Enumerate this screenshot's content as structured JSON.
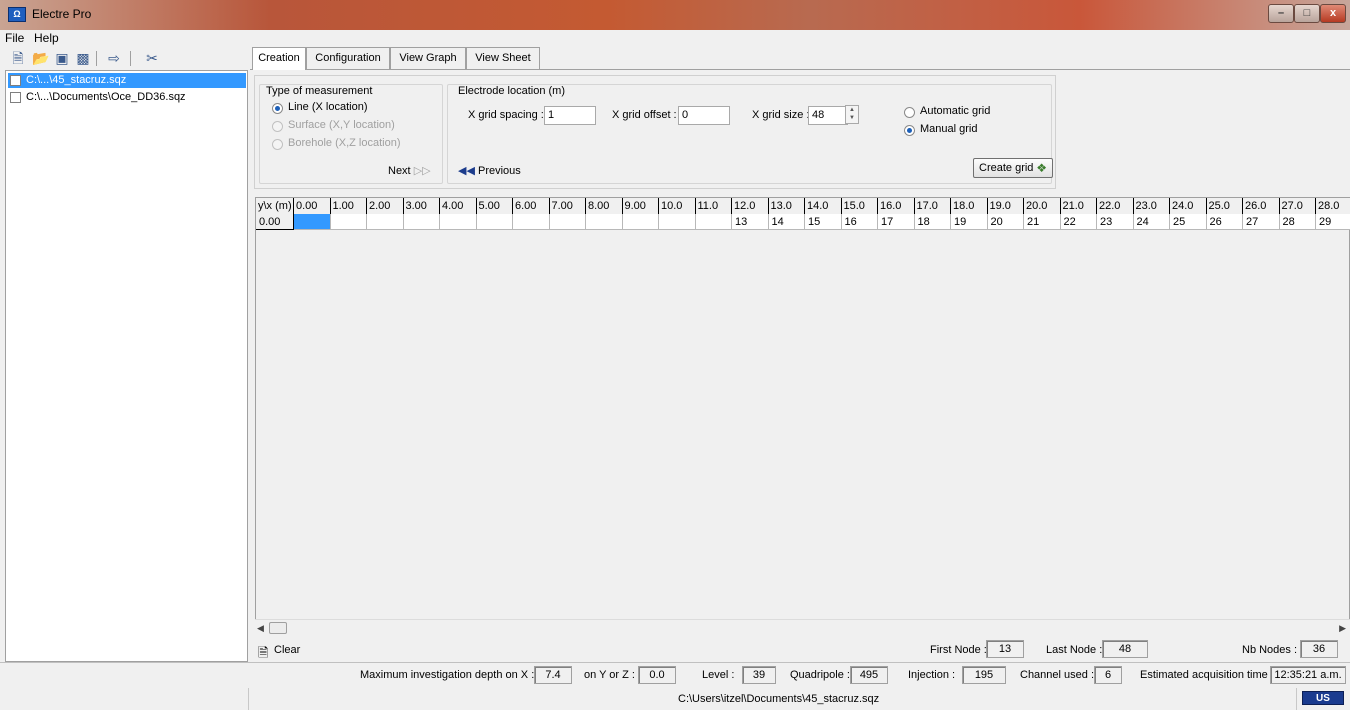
{
  "window": {
    "title": "Electre Pro",
    "icon": "electre-app-icon",
    "min": "–",
    "max": "□",
    "close": "x"
  },
  "menu": [
    "File",
    "Help"
  ],
  "files": [
    {
      "name": "C:\\...\\45_stacruz.sqz",
      "selected": true
    },
    {
      "name": "C:\\...\\Documents\\Oce_DD36.sqz",
      "selected": false
    }
  ],
  "tabs": [
    "Creation",
    "Configuration",
    "View Graph",
    "View Sheet"
  ],
  "creation": {
    "type_title": "Type of measurement",
    "radio_line": "Line (X location)",
    "radio_surface": "Surface (X,Y location)",
    "radio_borehole": "Borehole (X,Z location)",
    "next": "Next",
    "electrode_title": "Electrode location (m)",
    "x_spacing_label": "X grid spacing :",
    "x_spacing_value": "1",
    "x_offset_label": "X grid offset :",
    "x_offset_value": "0",
    "x_size_label": "X grid size :",
    "x_size_value": "48",
    "previous": "Previous",
    "auto_grid": "Automatic grid",
    "manual_grid": "Manual grid",
    "create_grid": "Create grid"
  },
  "grid": {
    "corner": "y\\x (m)",
    "columns": [
      "0.00",
      "1.00",
      "2.00",
      "3.00",
      "4.00",
      "5.00",
      "6.00",
      "7.00",
      "8.00",
      "9.00",
      "10.0",
      "11.0",
      "12.0",
      "13.0",
      "14.0",
      "15.0",
      "16.0",
      "17.0",
      "18.0",
      "19.0",
      "20.0",
      "21.0",
      "22.0",
      "23.0",
      "24.0",
      "25.0",
      "26.0",
      "27.0",
      "28.0"
    ],
    "row_label": "0.00",
    "row_values": [
      "",
      "",
      "",
      "",
      "",
      "",
      "",
      "",
      "",
      "",
      "",
      "",
      "13",
      "14",
      "15",
      "16",
      "17",
      "18",
      "19",
      "20",
      "21",
      "22",
      "23",
      "24",
      "25",
      "26",
      "27",
      "28",
      "29"
    ]
  },
  "bottom": {
    "clear": "Clear",
    "first_node_label": "First Node :",
    "first_node": "13",
    "last_node_label": "Last Node :",
    "last_node": "48",
    "nb_nodes_label": "Nb Nodes :",
    "nb_nodes": "36"
  },
  "status": {
    "depth_x_label": "Maximum investigation depth on X :",
    "depth_x": "7.4",
    "depth_yz_label": "on Y or Z :",
    "depth_yz": "0.0",
    "level_label": "Level :",
    "level": "39",
    "quadripole_label": "Quadripole :",
    "quadripole": "495",
    "injection_label": "Injection :",
    "injection": "195",
    "channel_label": "Channel used :",
    "channel": "6",
    "est_label": "Estimated acquisition time :",
    "est_time": "12:35:21 a.m.",
    "path": "C:\\Users\\itzel\\Documents\\45_stacruz.sqz",
    "flag": "US"
  },
  "colors": {
    "accent": "#3399ff",
    "selected_cell": "#3399ff",
    "title_gradient": "#b8563a"
  }
}
